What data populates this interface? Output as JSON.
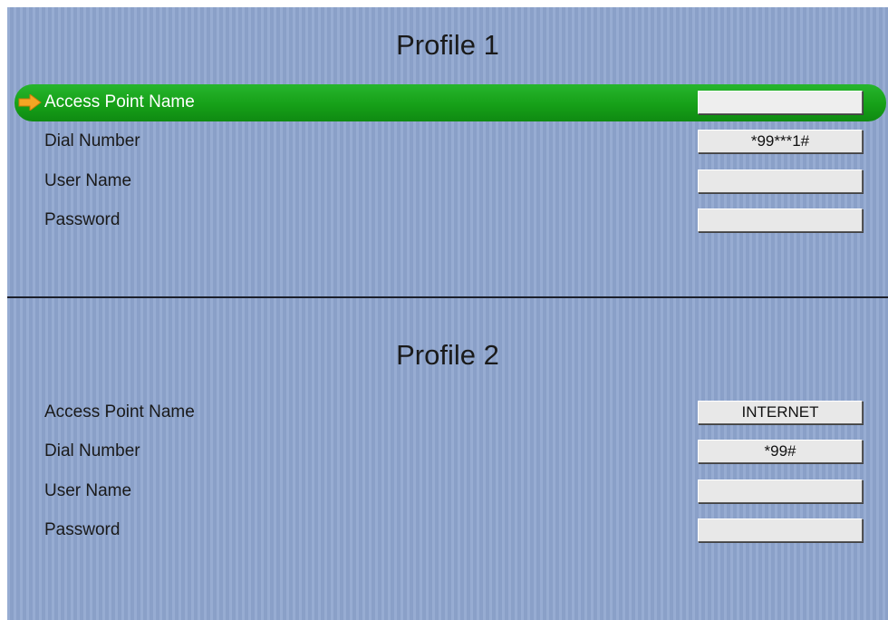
{
  "profiles": [
    {
      "title": "Profile 1",
      "fields": [
        {
          "label": "Access Point Name",
          "value": ""
        },
        {
          "label": "Dial Number",
          "value": "*99***1#"
        },
        {
          "label": "User Name",
          "value": ""
        },
        {
          "label": "Password",
          "value": ""
        }
      ]
    },
    {
      "title": "Profile 2",
      "fields": [
        {
          "label": "Access Point Name",
          "value": "INTERNET"
        },
        {
          "label": "Dial Number",
          "value": "*99#"
        },
        {
          "label": "User Name",
          "value": ""
        },
        {
          "label": "Password",
          "value": ""
        }
      ]
    }
  ],
  "selection": {
    "profile": 1,
    "field": "Access Point Name",
    "indicator_icon": "arrow-right-icon"
  },
  "colors": {
    "background": "#8fa6cf",
    "highlight": "#16a018",
    "arrow": "#f5a623",
    "field": "#e8e8e8",
    "divider": "#1b1f2a"
  }
}
